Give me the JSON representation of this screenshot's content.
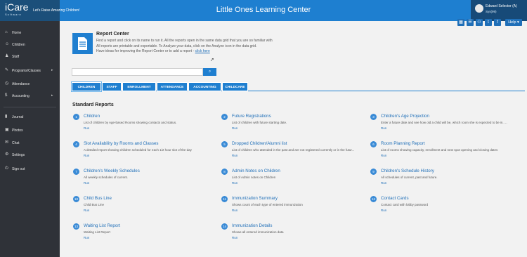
{
  "header": {
    "logo": "iCare",
    "logo_sub": "Software",
    "tagline": "Let's Raise Amazing Children!",
    "center_title": "Little Ones Learning Center",
    "user_name": "Edward Selector (A)",
    "user_sub": "Sys(99)"
  },
  "toolbar": {
    "icons": [
      "grid-icon",
      "list-icon",
      "people-icon",
      "twitter-icon",
      "facebook-icon",
      "email-icon"
    ],
    "icon_glyphs": [
      "▦",
      "☰",
      "⚇",
      "t",
      "f",
      "✉"
    ],
    "help_label": "Help ▾"
  },
  "sidebar": {
    "items": [
      {
        "label": "Home",
        "icon": "home-icon",
        "glyph": "⌂"
      },
      {
        "label": "Children",
        "icon": "children-icon",
        "glyph": "☺"
      },
      {
        "label": "Staff",
        "icon": "staff-icon",
        "glyph": "♟"
      },
      {
        "label": "Programs/Classes",
        "icon": "programs-icon",
        "glyph": "✎",
        "caret": "▸"
      },
      {
        "label": "Attendance",
        "icon": "attendance-icon",
        "glyph": "◷"
      },
      {
        "label": "Accounting",
        "icon": "dollar-icon",
        "glyph": "$",
        "caret": "▸"
      },
      {
        "label": "Journal",
        "icon": "journal-icon",
        "glyph": "▮"
      },
      {
        "label": "Photos",
        "icon": "photos-icon",
        "glyph": "▣"
      },
      {
        "label": "Chat",
        "icon": "chat-icon",
        "glyph": "✉"
      },
      {
        "label": "Settings",
        "icon": "settings-icon",
        "glyph": "⚙"
      },
      {
        "label": "Sign out",
        "icon": "signout-icon",
        "glyph": "⏻"
      }
    ]
  },
  "report_center": {
    "title": "Report Center",
    "line1": "Find a report and click on its name to run it. All the reports open in the same data grid that you are so familiar with",
    "line2": "All reports are printable and exportable. To Analyze your data, click on the Analyze icon in the data grid.",
    "line3": "Have ideas for improving the Report Center or to add a report - ",
    "link": "click here"
  },
  "search": {
    "placeholder": "",
    "button_glyph": "⌕"
  },
  "tabs": [
    "CHILDREN",
    "STAFF",
    "ENROLLMENT",
    "ATTENDANCE",
    "ACCOUNTING",
    "CHILDCARE"
  ],
  "standard_reports_title": "Standard Reports",
  "reports": [
    {
      "n": "1",
      "name": "Children",
      "desc": "List of children by Age-based Rooms showing contacts and status.",
      "run": "Run"
    },
    {
      "n": "2",
      "name": "Future Registrations",
      "desc": "List of children with future starting date.",
      "run": "Run"
    },
    {
      "n": "3",
      "name": "Children's Age Projection",
      "desc": "Enter a future date and see how old a child will be, which room she is expected to be in. ...",
      "run": "Run"
    },
    {
      "n": "4",
      "name": "Slot Availability by Rooms and Classes",
      "desc": "A detailed report showing children scheduled for each 1/2 hour slot of the day",
      "run": "Run"
    },
    {
      "n": "5",
      "name": "Dropped Children/Alumni list",
      "desc": "List of children who attended in the past and are not registered currently or in the futur...",
      "run": "Run"
    },
    {
      "n": "6",
      "name": "Room Planning Report",
      "desc": "List of rooms showing capacity, enrollment and next spot opening and closing dates",
      "run": "Run"
    },
    {
      "n": "7",
      "name": "Children's Weekly Schedules",
      "desc": "All weekly schedules of current.",
      "run": "Run"
    },
    {
      "n": "8",
      "name": "Admin Notes on Children",
      "desc": "List of Admin notes on Children",
      "run": "Run"
    },
    {
      "n": "9",
      "name": "Children's Schedule History",
      "desc": "All schedules of current, past and future.",
      "run": "Run"
    },
    {
      "n": "10",
      "name": "Child Bus Line",
      "desc": "Child Bus Line",
      "run": "Run"
    },
    {
      "n": "11",
      "name": "Immunization Summary",
      "desc": "Shows count of each type of entered immunization",
      "run": "Run"
    },
    {
      "n": "12",
      "name": "Contact Cards",
      "desc": "Contact card with lobby password",
      "run": "Run"
    },
    {
      "n": "13",
      "name": "Waiting List Report",
      "desc": "Waiting List Report",
      "run": "Run"
    },
    {
      "n": "14",
      "name": "Immunization Details",
      "desc": "Shows all entered immunization data",
      "run": "Run"
    }
  ]
}
